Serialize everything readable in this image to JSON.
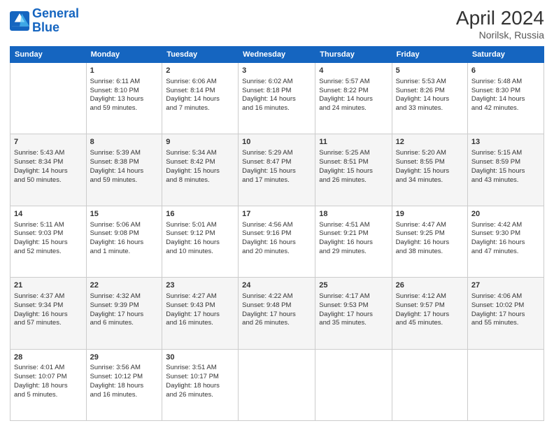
{
  "header": {
    "logo_line1": "General",
    "logo_line2": "Blue",
    "title": "April 2024",
    "subtitle": "Norilsk, Russia"
  },
  "weekdays": [
    "Sunday",
    "Monday",
    "Tuesday",
    "Wednesday",
    "Thursday",
    "Friday",
    "Saturday"
  ],
  "weeks": [
    [
      {
        "day": "",
        "content": ""
      },
      {
        "day": "1",
        "content": "Sunrise: 6:11 AM\nSunset: 8:10 PM\nDaylight: 13 hours\nand 59 minutes."
      },
      {
        "day": "2",
        "content": "Sunrise: 6:06 AM\nSunset: 8:14 PM\nDaylight: 14 hours\nand 7 minutes."
      },
      {
        "day": "3",
        "content": "Sunrise: 6:02 AM\nSunset: 8:18 PM\nDaylight: 14 hours\nand 16 minutes."
      },
      {
        "day": "4",
        "content": "Sunrise: 5:57 AM\nSunset: 8:22 PM\nDaylight: 14 hours\nand 24 minutes."
      },
      {
        "day": "5",
        "content": "Sunrise: 5:53 AM\nSunset: 8:26 PM\nDaylight: 14 hours\nand 33 minutes."
      },
      {
        "day": "6",
        "content": "Sunrise: 5:48 AM\nSunset: 8:30 PM\nDaylight: 14 hours\nand 42 minutes."
      }
    ],
    [
      {
        "day": "7",
        "content": "Sunrise: 5:43 AM\nSunset: 8:34 PM\nDaylight: 14 hours\nand 50 minutes."
      },
      {
        "day": "8",
        "content": "Sunrise: 5:39 AM\nSunset: 8:38 PM\nDaylight: 14 hours\nand 59 minutes."
      },
      {
        "day": "9",
        "content": "Sunrise: 5:34 AM\nSunset: 8:42 PM\nDaylight: 15 hours\nand 8 minutes."
      },
      {
        "day": "10",
        "content": "Sunrise: 5:29 AM\nSunset: 8:47 PM\nDaylight: 15 hours\nand 17 minutes."
      },
      {
        "day": "11",
        "content": "Sunrise: 5:25 AM\nSunset: 8:51 PM\nDaylight: 15 hours\nand 26 minutes."
      },
      {
        "day": "12",
        "content": "Sunrise: 5:20 AM\nSunset: 8:55 PM\nDaylight: 15 hours\nand 34 minutes."
      },
      {
        "day": "13",
        "content": "Sunrise: 5:15 AM\nSunset: 8:59 PM\nDaylight: 15 hours\nand 43 minutes."
      }
    ],
    [
      {
        "day": "14",
        "content": "Sunrise: 5:11 AM\nSunset: 9:03 PM\nDaylight: 15 hours\nand 52 minutes."
      },
      {
        "day": "15",
        "content": "Sunrise: 5:06 AM\nSunset: 9:08 PM\nDaylight: 16 hours\nand 1 minute."
      },
      {
        "day": "16",
        "content": "Sunrise: 5:01 AM\nSunset: 9:12 PM\nDaylight: 16 hours\nand 10 minutes."
      },
      {
        "day": "17",
        "content": "Sunrise: 4:56 AM\nSunset: 9:16 PM\nDaylight: 16 hours\nand 20 minutes."
      },
      {
        "day": "18",
        "content": "Sunrise: 4:51 AM\nSunset: 9:21 PM\nDaylight: 16 hours\nand 29 minutes."
      },
      {
        "day": "19",
        "content": "Sunrise: 4:47 AM\nSunset: 9:25 PM\nDaylight: 16 hours\nand 38 minutes."
      },
      {
        "day": "20",
        "content": "Sunrise: 4:42 AM\nSunset: 9:30 PM\nDaylight: 16 hours\nand 47 minutes."
      }
    ],
    [
      {
        "day": "21",
        "content": "Sunrise: 4:37 AM\nSunset: 9:34 PM\nDaylight: 16 hours\nand 57 minutes."
      },
      {
        "day": "22",
        "content": "Sunrise: 4:32 AM\nSunset: 9:39 PM\nDaylight: 17 hours\nand 6 minutes."
      },
      {
        "day": "23",
        "content": "Sunrise: 4:27 AM\nSunset: 9:43 PM\nDaylight: 17 hours\nand 16 minutes."
      },
      {
        "day": "24",
        "content": "Sunrise: 4:22 AM\nSunset: 9:48 PM\nDaylight: 17 hours\nand 26 minutes."
      },
      {
        "day": "25",
        "content": "Sunrise: 4:17 AM\nSunset: 9:53 PM\nDaylight: 17 hours\nand 35 minutes."
      },
      {
        "day": "26",
        "content": "Sunrise: 4:12 AM\nSunset: 9:57 PM\nDaylight: 17 hours\nand 45 minutes."
      },
      {
        "day": "27",
        "content": "Sunrise: 4:06 AM\nSunset: 10:02 PM\nDaylight: 17 hours\nand 55 minutes."
      }
    ],
    [
      {
        "day": "28",
        "content": "Sunrise: 4:01 AM\nSunset: 10:07 PM\nDaylight: 18 hours\nand 5 minutes."
      },
      {
        "day": "29",
        "content": "Sunrise: 3:56 AM\nSunset: 10:12 PM\nDaylight: 18 hours\nand 16 minutes."
      },
      {
        "day": "30",
        "content": "Sunrise: 3:51 AM\nSunset: 10:17 PM\nDaylight: 18 hours\nand 26 minutes."
      },
      {
        "day": "",
        "content": ""
      },
      {
        "day": "",
        "content": ""
      },
      {
        "day": "",
        "content": ""
      },
      {
        "day": "",
        "content": ""
      }
    ]
  ]
}
